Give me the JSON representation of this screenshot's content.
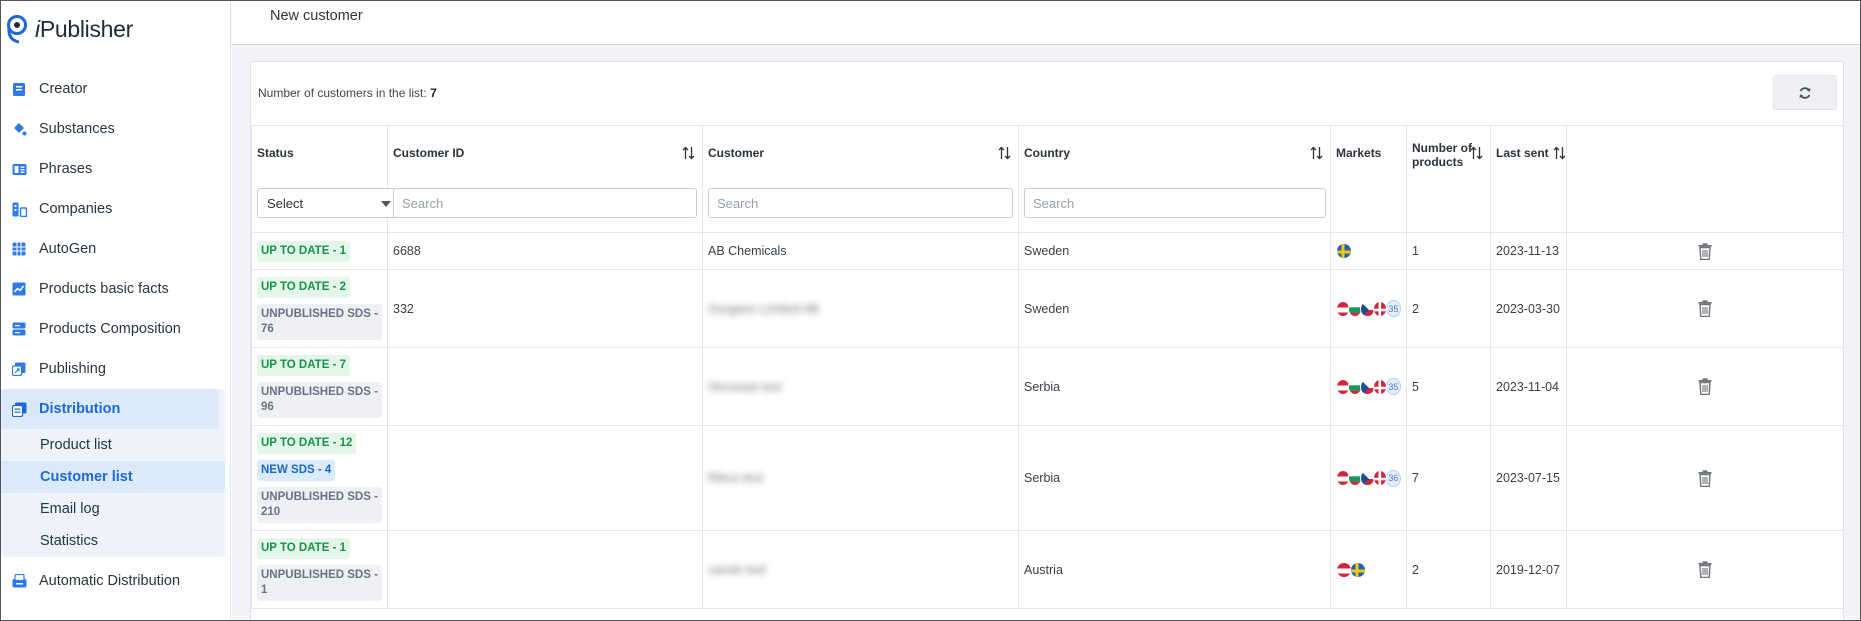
{
  "app": {
    "logo_text": "Publisher",
    "logo_prefix": "i"
  },
  "sidebar": {
    "items": [
      {
        "label": "Creator",
        "icon": "book-icon"
      },
      {
        "label": "Substances",
        "icon": "flask-icon"
      },
      {
        "label": "Phrases",
        "icon": "phrasebook-icon"
      },
      {
        "label": "Companies",
        "icon": "building-icon"
      },
      {
        "label": "AutoGen",
        "icon": "grid-icon"
      },
      {
        "label": "Products basic facts",
        "icon": "chart-icon"
      },
      {
        "label": "Products Composition",
        "icon": "layers-icon"
      },
      {
        "label": "Publishing",
        "icon": "publish-icon"
      },
      {
        "label": "Distribution",
        "icon": "distribution-icon"
      },
      {
        "label": "Automatic Distribution",
        "icon": "inbox-icon"
      }
    ],
    "sub_items": [
      "Product list",
      "Customer list",
      "Email log",
      "Statistics"
    ],
    "active_item": "Distribution",
    "active_sub": "Customer list"
  },
  "topbar": {
    "new_customer": "New customer"
  },
  "list": {
    "count_label": "Number of customers in the list: ",
    "count_value": "7"
  },
  "table": {
    "headers": {
      "status": "Status",
      "customer_id": "Customer ID",
      "customer": "Customer",
      "country": "Country",
      "markets": "Markets",
      "products_line1": "Number of",
      "products_line2": "products",
      "last_sent": "Last sent"
    },
    "filters": {
      "status_select": "Select",
      "search_placeholder": "Search"
    },
    "rows": [
      {
        "badges": [
          {
            "text": "UP TO DATE - 1",
            "kind": "green"
          }
        ],
        "customer_id": "6688",
        "customer": "AB Chemicals",
        "customer_blurred": false,
        "country": "Sweden",
        "flags": [
          "se"
        ],
        "more": "",
        "products": "1",
        "last_sent": "2023-11-13"
      },
      {
        "badges": [
          {
            "text": "UP TO DATE - 2",
            "kind": "green"
          },
          {
            "text": "UNPUBLISHED SDS - 76",
            "kind": "gray"
          }
        ],
        "customer_id": "332",
        "customer": "Gorgans Limited AB",
        "customer_blurred": true,
        "country": "Sweden",
        "flags": [
          "at",
          "bg",
          "cz",
          "dk"
        ],
        "more": "35",
        "products": "2",
        "last_sent": "2023-03-30"
      },
      {
        "badges": [
          {
            "text": "UP TO DATE - 7",
            "kind": "green"
          },
          {
            "text": "UNPUBLISHED SDS - 96",
            "kind": "gray"
          }
        ],
        "customer_id": "",
        "customer": "Herzeast test",
        "customer_blurred": true,
        "country": "Serbia",
        "flags": [
          "at",
          "bg",
          "cz",
          "dk"
        ],
        "more": "35",
        "products": "5",
        "last_sent": "2023-11-04"
      },
      {
        "badges": [
          {
            "text": "UP TO DATE - 12",
            "kind": "green"
          },
          {
            "text": "NEW SDS - 4",
            "kind": "blue"
          },
          {
            "text": "UNPUBLISHED SDS - 210",
            "kind": "gray"
          }
        ],
        "customer_id": "",
        "customer": "Rikos test",
        "customer_blurred": true,
        "country": "Serbia",
        "flags": [
          "at",
          "bg",
          "cz",
          "dk"
        ],
        "more": "36",
        "products": "7",
        "last_sent": "2023-07-15"
      },
      {
        "badges": [
          {
            "text": "UP TO DATE - 1",
            "kind": "green"
          },
          {
            "text": "UNPUBLISHED SDS - 1",
            "kind": "gray"
          }
        ],
        "customer_id": "",
        "customer": "carole test",
        "customer_blurred": true,
        "country": "Austria",
        "flags": [
          "at",
          "se"
        ],
        "more": "",
        "products": "2",
        "last_sent": "2019-12-07"
      }
    ]
  },
  "colors": {
    "accent": "#1b6ad8",
    "active_bg": "#dce9fb",
    "green_badge": "#159447",
    "blue_badge": "#1a67c9",
    "gray_badge": "#6b7280"
  }
}
